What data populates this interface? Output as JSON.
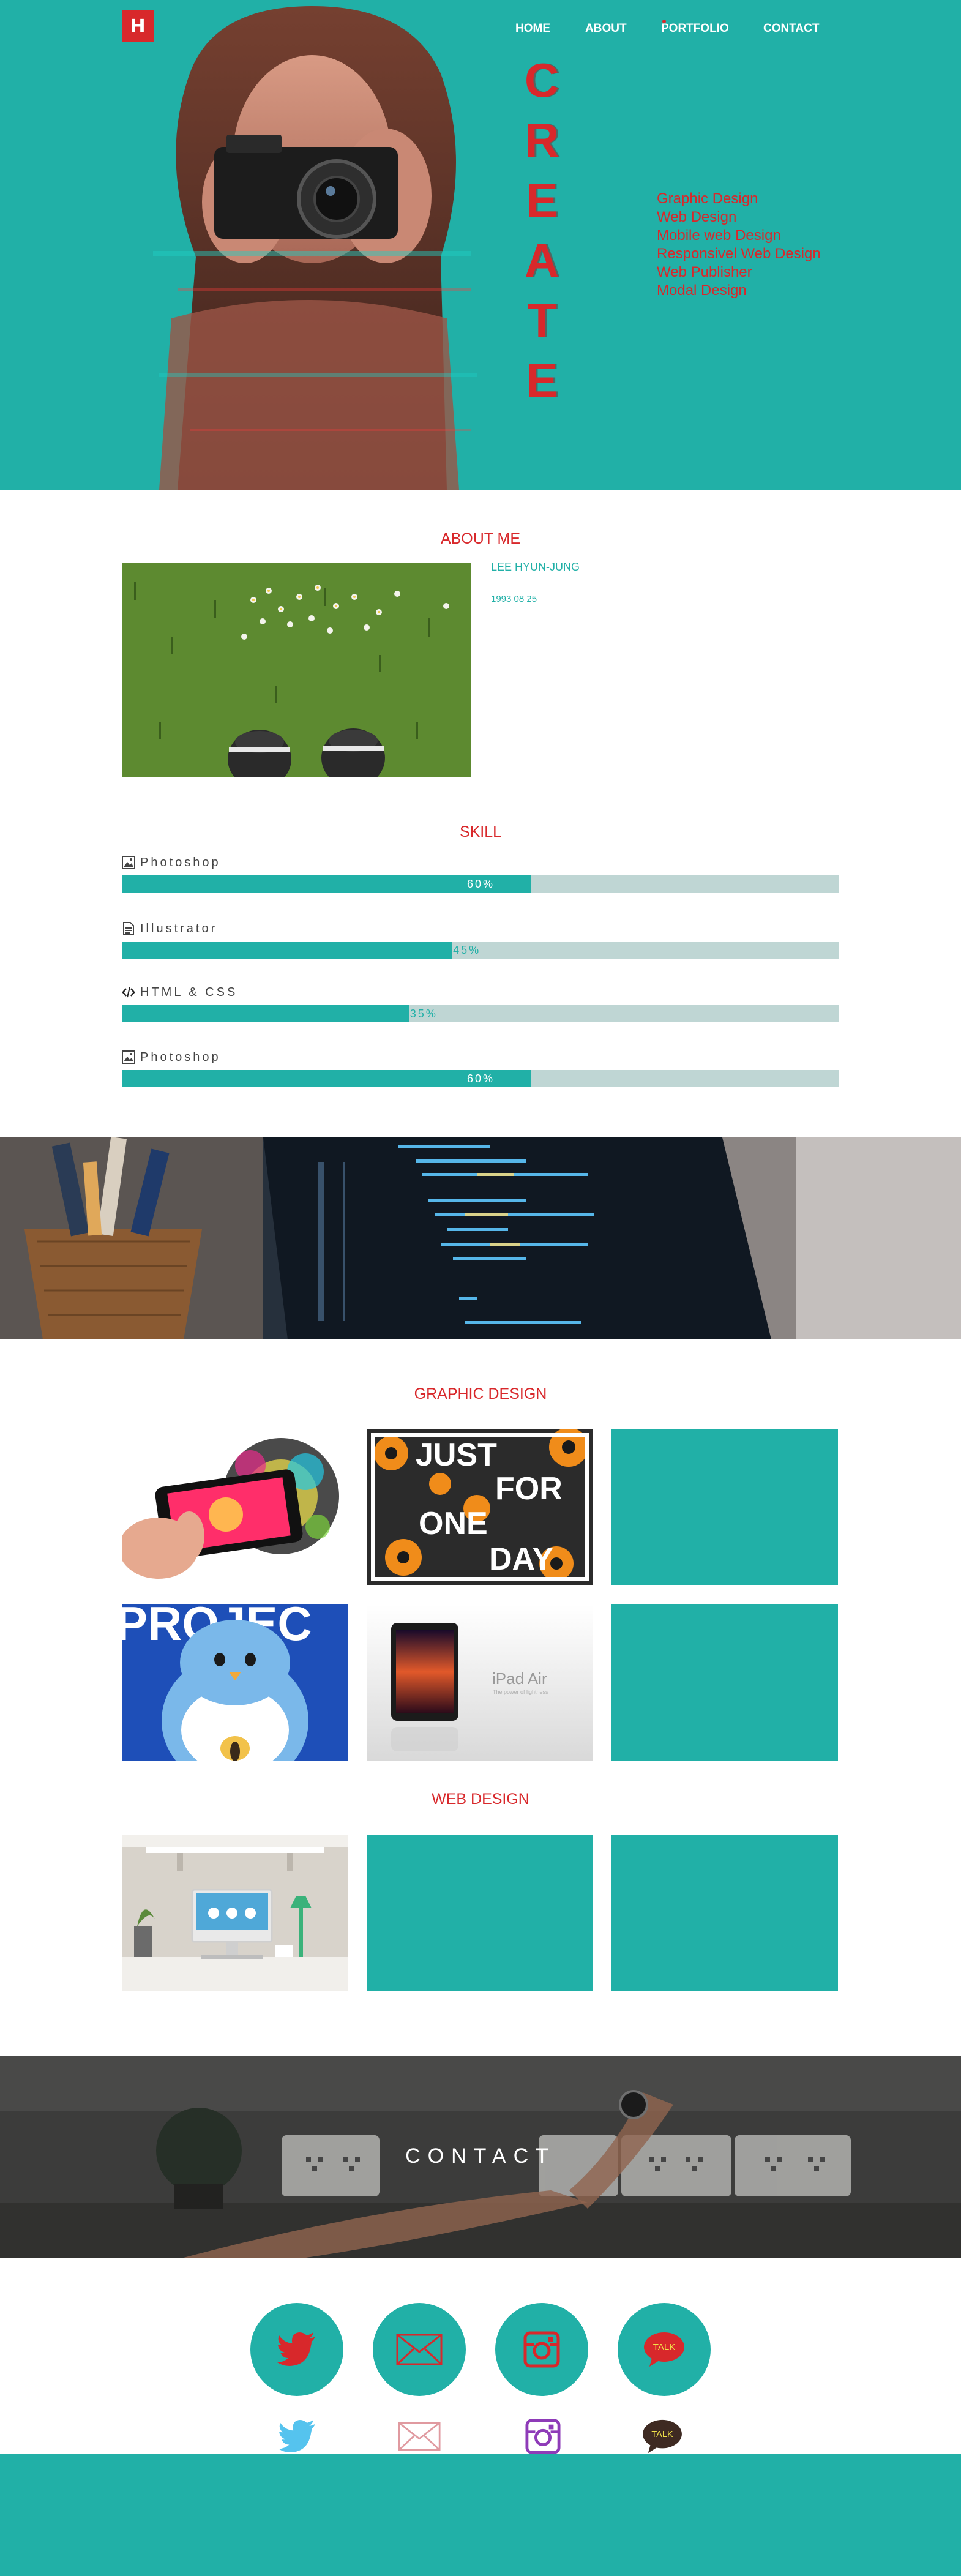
{
  "logo": {
    "text": "H"
  },
  "nav": [
    {
      "label": "HOME"
    },
    {
      "label": "ABOUT"
    },
    {
      "label": "PORTFOLIO"
    },
    {
      "label": "CONTACT"
    }
  ],
  "hero": {
    "vertical_word": [
      "C",
      "R",
      "E",
      "A",
      "T",
      "E"
    ],
    "services": [
      "Graphic Design",
      "Web Design",
      "Mobile web Design",
      "Responsivel Web Design",
      "Web Publisher",
      "Modal Design"
    ]
  },
  "about": {
    "title": "ABOUT ME",
    "name": "LEE HYUN-JUNG",
    "birthdate": "1993 08 25"
  },
  "skills": {
    "title": "SKILL",
    "items": [
      {
        "name": "Photoshop",
        "percent_label": "60%",
        "level": 0.57,
        "icon": "image-icon"
      },
      {
        "name": "Illustrator",
        "percent_label": "45%",
        "level": 0.46,
        "icon": "document-icon"
      },
      {
        "name": "HTML & CSS",
        "percent_label": "35%",
        "level": 0.4,
        "icon": "code-icon"
      },
      {
        "name": "Photoshop",
        "percent_label": "60%",
        "level": 0.57,
        "icon": "image-icon"
      }
    ]
  },
  "graphic": {
    "title": "GRAPHIC DESIGN",
    "tile2": {
      "line1": "JUST",
      "line2": "FOR",
      "line3": "ONE",
      "line4": "DAY"
    },
    "tile4": {
      "banner": "PROJEC"
    },
    "tile5": {
      "product": "iPad Air",
      "tagline": "The power of lightness"
    }
  },
  "web": {
    "title": "WEB DESIGN"
  },
  "contact": {
    "title": "CONTACT"
  },
  "social": {
    "kakao_label": "TALK",
    "icons": [
      "twitter-icon",
      "mail-icon",
      "instagram-icon",
      "kakaotalk-icon"
    ]
  },
  "colors": {
    "teal": "#21b0a7",
    "red": "#d8282b",
    "track": "#bfd6d4"
  }
}
